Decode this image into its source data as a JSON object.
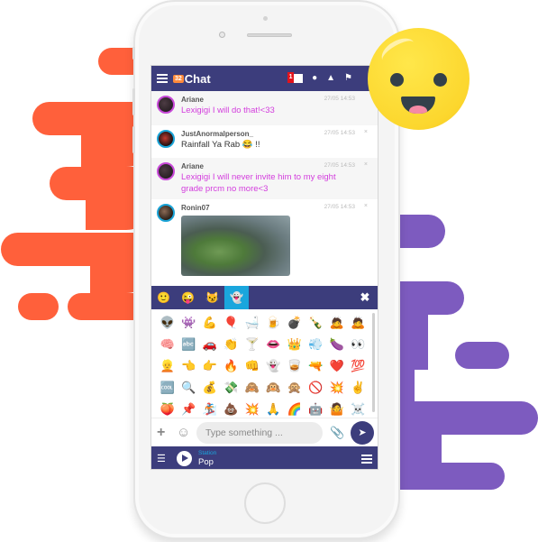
{
  "app": {
    "logo_badge": "32",
    "title": "Chat",
    "mail_badge": "1"
  },
  "header_icons": [
    "menu-icon",
    "mail-icon",
    "user-icon",
    "bell-icon",
    "flag-icon",
    "avatar"
  ],
  "messages": [
    {
      "name": "Ariane",
      "time": "27/05 14:53",
      "text": "Lexigigi I will do that!<33",
      "style": "pink",
      "closable": false
    },
    {
      "name": "JustAnormalperson_",
      "time": "27/05 14:53",
      "text": "Rainfall Ya Rab 😂 !!",
      "style": "normal",
      "closable": true
    },
    {
      "name": "Ariane",
      "time": "27/05 14:53",
      "text": "Lexigigi I will never invite him to my eight grade prcm no more<3",
      "style": "pink",
      "closable": true
    },
    {
      "name": "Ronin07",
      "time": "27/05 14:53",
      "text": "",
      "style": "normal",
      "closable": true,
      "attachment": "gif-image"
    }
  ],
  "close_glyph": "×",
  "emoji_tabs": [
    {
      "glyph": "🙂",
      "name": "smileys",
      "active": false
    },
    {
      "glyph": "😜",
      "name": "faces",
      "active": false
    },
    {
      "glyph": "😼",
      "name": "cats",
      "active": false
    },
    {
      "glyph": "👻",
      "name": "misc",
      "active": true
    }
  ],
  "emoji_close": "✖",
  "emojis": [
    "👽",
    "👾",
    "💪",
    "🎈",
    "🛁",
    "🍺",
    "💣",
    "🍾",
    "🙇",
    "🙇",
    "🧠",
    "🔤",
    "🚗",
    "👏",
    "🍸",
    "👄",
    "👑",
    "💨",
    "🍆",
    "👀",
    "👱",
    "👈",
    "👉",
    "🔥",
    "👊",
    "👻",
    "🥃",
    "🔫",
    "❤️",
    "💯",
    "🆒",
    "🔍",
    "💰",
    "💸",
    "🙈",
    "🙉",
    "🙊",
    "🚫",
    "💥",
    "✌️",
    "🍑",
    "📌",
    "🏂",
    "💩",
    "💥",
    "🙏",
    "🌈",
    "🤖",
    "🤷",
    "☠️"
  ],
  "composer": {
    "plus": "+",
    "emoji_button": "☺",
    "placeholder": "Type something ...",
    "attach": "📎",
    "send": "➤"
  },
  "player": {
    "eq_icon": "☰",
    "station_label": "Station",
    "station_name": "Pop"
  },
  "colors": {
    "primary": "#3c3d7c",
    "accent": "#1aa6dd",
    "pink_text": "#d33ddd",
    "orange_blob": "#ff603b",
    "purple_blob": "#7d5bbf"
  }
}
